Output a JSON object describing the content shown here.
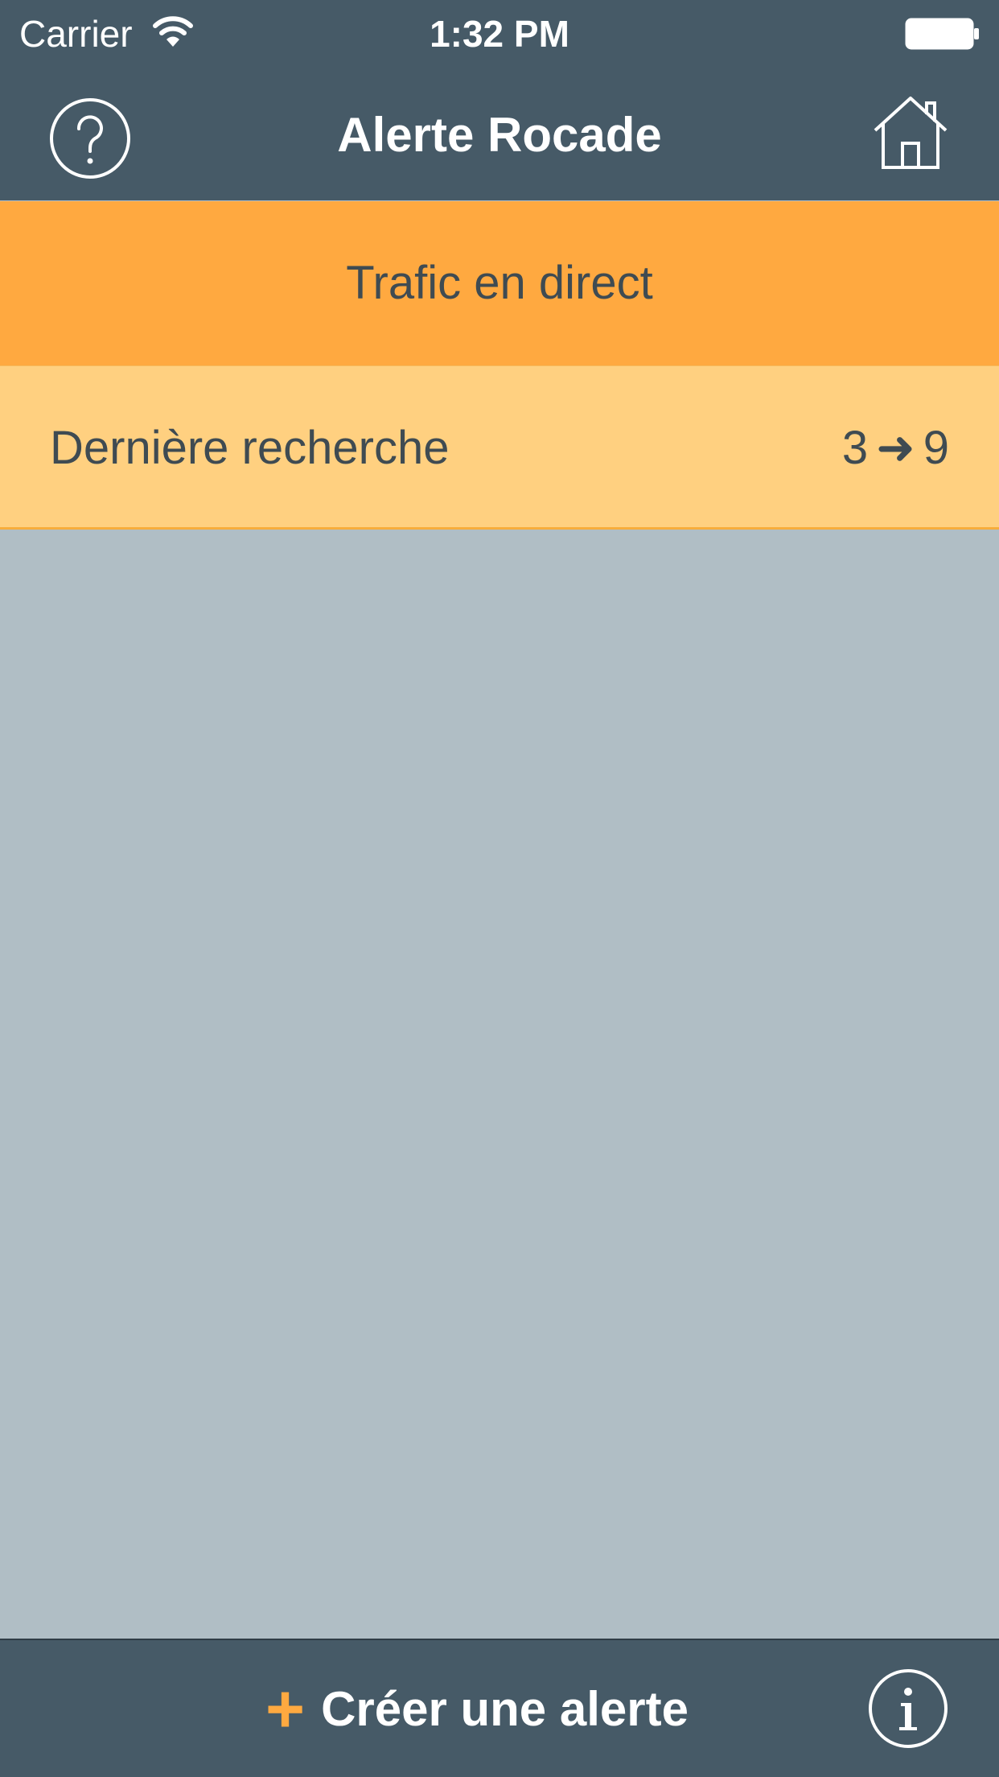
{
  "status_bar": {
    "carrier": "Carrier",
    "time": "1:32 PM",
    "wifi_icon": "wifi-icon",
    "battery_icon": "battery-icon"
  },
  "nav": {
    "title": "Alerte Rocade",
    "help_icon": "question-circle-icon",
    "home_icon": "home-icon"
  },
  "live_traffic": {
    "label": "Trafic en direct"
  },
  "last_search": {
    "label": "Dernière recherche",
    "from": "3",
    "arrow": "➜",
    "to": "9"
  },
  "bottom_bar": {
    "plus": "+",
    "create_label": "Créer une alerte",
    "info_icon": "info-circle-icon"
  },
  "colors": {
    "bar_background": "#465a67",
    "live_traffic_background": "#ffa940",
    "last_search_background": "#ffd080",
    "content_background": "#b0bec5",
    "accent": "#ffa940"
  }
}
